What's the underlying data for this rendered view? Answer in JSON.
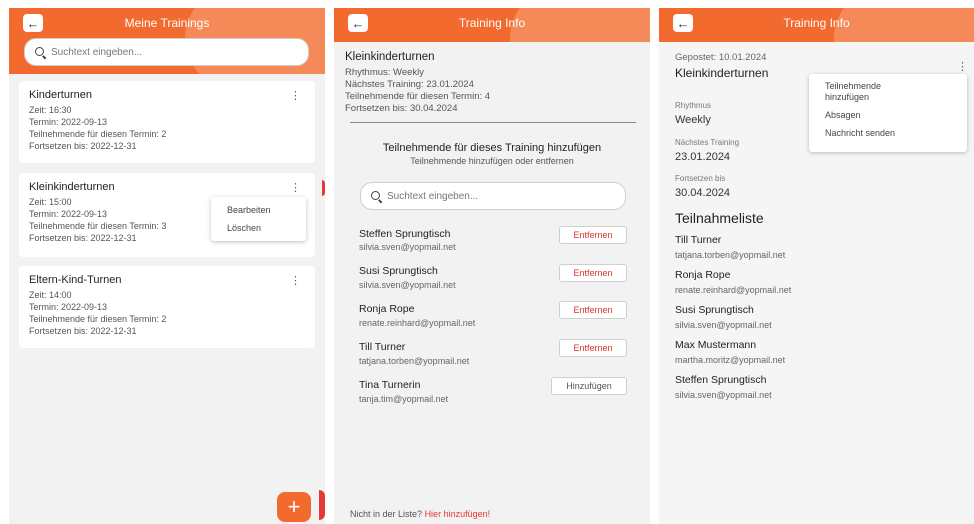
{
  "screen1": {
    "title": "Meine Trainings",
    "search_placeholder": "Suchtext eingeben...",
    "cards": [
      {
        "name": "Kinderturnen",
        "zeit": "Zeit: 16:30",
        "termin": "Termin: 2022-09-13",
        "teilnehmende": "Teilnehmende für diesen Termin: 2",
        "fortsetzen": "Fortsetzen bis: 2022-12-31"
      },
      {
        "name": "Kleinkinderturnen",
        "zeit": "Zeit: 15:00",
        "termin": "Termin: 2022-09-13",
        "teilnehmende": "Teilnehmende für diesen Termin: 3",
        "fortsetzen": "Fortsetzen bis: 2022-12-31"
      },
      {
        "name": "Eltern-Kind-Turnen",
        "zeit": "Zeit: 14:00",
        "termin": "Termin: 2022-09-13",
        "teilnehmende": "Teilnehmende für diesen Termin: 2",
        "fortsetzen": "Fortsetzen bis: 2022-12-31"
      }
    ],
    "context_menu": {
      "edit": "Bearbeiten",
      "delete": "Löschen"
    },
    "fab_label": "+"
  },
  "screen2": {
    "title": "Training Info",
    "training_name": "Kleinkinderturnen",
    "rhythmus": "Rhythmus: Weekly",
    "naechstes": "Nächstes Training: 23.01.2024",
    "teilnehmende": "Teilnehmende für diesen Termin: 4",
    "fortsetzen": "Fortsetzen bis: 30.04.2024",
    "section_title": "Teilnehmende für dieses Training hinzufügen",
    "section_subtitle": "Teilnehmende hinzufügen oder entfernen",
    "search_placeholder": "Suchtext eingeben...",
    "participants": [
      {
        "name": "Steffen Sprungtisch",
        "email": "silvia.sven@yopmail.net",
        "action": "Entfernen"
      },
      {
        "name": "Susi Sprungtisch",
        "email": "silvia.sven@yopmail.net",
        "action": "Entfernen"
      },
      {
        "name": "Ronja Rope",
        "email": "renate.reinhard@yopmail.net",
        "action": "Entfernen"
      },
      {
        "name": "Till Turner",
        "email": "tatjana.torben@yopmail.net",
        "action": "Entfernen"
      },
      {
        "name": "Tina Turnerin",
        "email": "tanja.tim@yopmail.net",
        "action": "Hinzufügen"
      }
    ],
    "footer_text": "Nicht in der Liste?",
    "footer_link": "Hier hinzufügen!"
  },
  "screen3": {
    "title": "Training Info",
    "gepostet": "Gepostet: 10.01.2024",
    "training_name": "Kleinkinderturnen",
    "rhythmus_label": "Rhythmus",
    "rhythmus_value": "Weekly",
    "naechstes_label": "Nächstes Training",
    "naechstes_value": "23.01.2024",
    "fortsetzen_label": "Fortsetzen bis",
    "fortsetzen_value": "30.04.2024",
    "list_title": "Teilnahmeliste",
    "participants": [
      {
        "name": "Till Turner",
        "email": "tatjana.torben@yopmail.net"
      },
      {
        "name": "Ronja Rope",
        "email": "renate.reinhard@yopmail.net"
      },
      {
        "name": "Susi Sprungtisch",
        "email": "silvia.sven@yopmail.net"
      },
      {
        "name": "Max Mustermann",
        "email": "martha.moritz@yopmail.net"
      },
      {
        "name": "Steffen Sprungtisch",
        "email": "silvia.sven@yopmail.net"
      }
    ],
    "menu": {
      "add_line1": "Teilnehmende",
      "add_line2": "hinzufügen",
      "cancel": "Absagen",
      "message": "Nachricht senden"
    }
  },
  "colors": {
    "accent": "#f26a2e",
    "accent_light": "#f9a27c",
    "danger": "#d9342b"
  }
}
